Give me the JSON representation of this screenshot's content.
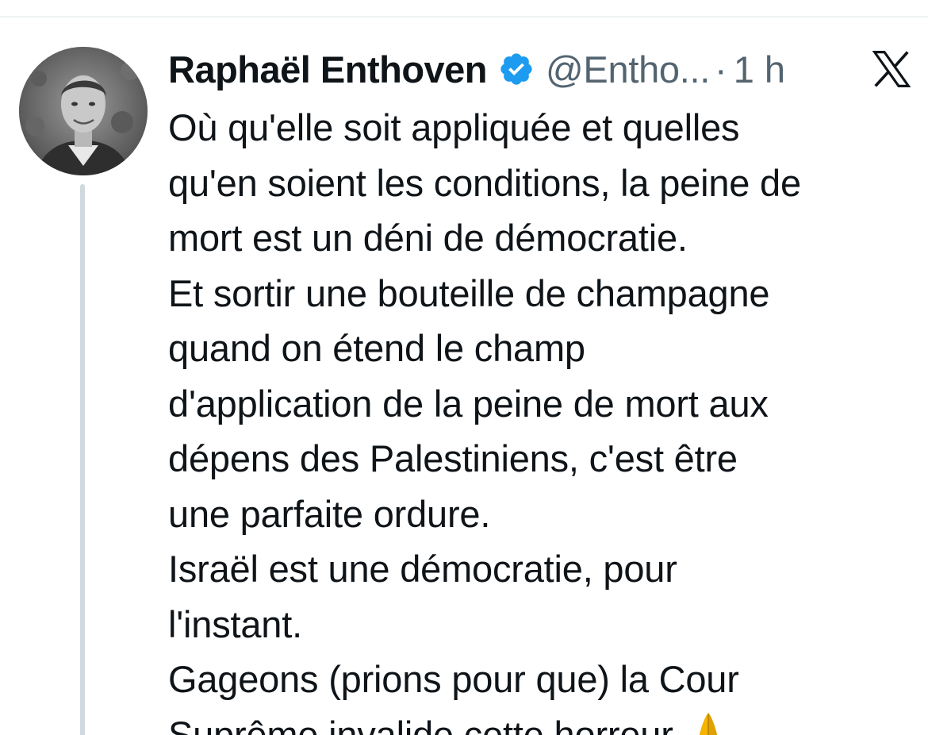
{
  "tweet": {
    "author": {
      "name": "Raphaël Enthoven",
      "handle": "@Entho...",
      "verified_icon": "verified-badge-icon",
      "avatar": "profile-photo"
    },
    "separator": "·",
    "timestamp": "1 h",
    "platform_icon": "x-logo-icon",
    "text_lines": [
      "Où qu'elle soit appliquée et quelles",
      "qu'en soient les conditions, la peine de",
      "mort est un déni de démocratie.",
      "Et sortir une bouteille de champagne",
      "quand on étend le champ",
      "d'application de la peine de mort aux",
      "dépens des Palestiniens, c'est être",
      "une parfaite ordure.",
      "Israël est une démocratie, pour",
      "l'instant.",
      "Gageons (prions pour que) la Cour",
      "Suprême invalide cette horreur."
    ],
    "trailing_emoji": "folded-hands-icon"
  },
  "colors": {
    "text": "#0f1419",
    "secondary_text": "#536471",
    "verified_blue": "#1d9bf0",
    "thread_line": "#cfd9de",
    "divider": "#eff3f4",
    "emoji": "#f4b400"
  }
}
